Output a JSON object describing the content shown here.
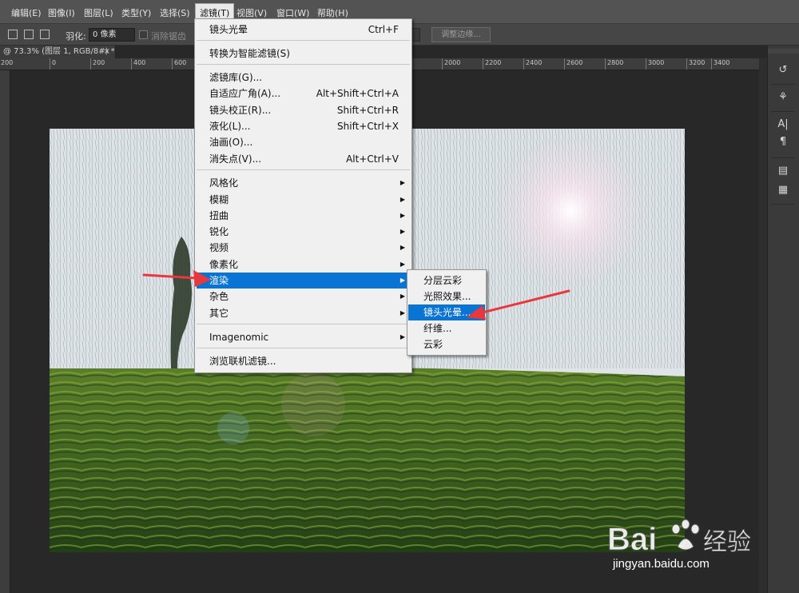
{
  "menubar": {
    "items": [
      {
        "label": "编辑(E)"
      },
      {
        "label": "图像(I)"
      },
      {
        "label": "图层(L)"
      },
      {
        "label": "类型(Y)"
      },
      {
        "label": "选择(S)"
      },
      {
        "label": "滤镜(T)",
        "active": true
      },
      {
        "label": "视图(V)"
      },
      {
        "label": "窗口(W)"
      },
      {
        "label": "帮助(H)"
      }
    ]
  },
  "options": {
    "feather_label": "羽化:",
    "feather_value": "0 像素",
    "antialias_label": "消除锯齿",
    "refine_edge_label": "调整边缘..."
  },
  "document": {
    "tab_title": "@ 73.3% (图层 1, RGB/8#) *",
    "close": "×"
  },
  "ruler": {
    "labels": [
      "200",
      "0",
      "200",
      "400",
      "600",
      "2000",
      "2200",
      "2400",
      "2600",
      "2800",
      "3000",
      "3200",
      "3400"
    ]
  },
  "filter_menu": {
    "items": [
      {
        "label": "镜头光晕",
        "shortcut": "Ctrl+F"
      },
      {
        "label": "转换为智能滤镜(S)"
      },
      {
        "label": "滤镜库(G)..."
      },
      {
        "label": "自适应广角(A)...",
        "shortcut": "Alt+Shift+Ctrl+A"
      },
      {
        "label": "镜头校正(R)...",
        "shortcut": "Shift+Ctrl+R"
      },
      {
        "label": "液化(L)...",
        "shortcut": "Shift+Ctrl+X"
      },
      {
        "label": "油画(O)..."
      },
      {
        "label": "消失点(V)...",
        "shortcut": "Alt+Ctrl+V"
      },
      {
        "label": "风格化",
        "submenu": true
      },
      {
        "label": "模糊",
        "submenu": true
      },
      {
        "label": "扭曲",
        "submenu": true
      },
      {
        "label": "锐化",
        "submenu": true
      },
      {
        "label": "视频",
        "submenu": true
      },
      {
        "label": "像素化",
        "submenu": true
      },
      {
        "label": "渲染",
        "submenu": true,
        "highlighted": true
      },
      {
        "label": "杂色",
        "submenu": true
      },
      {
        "label": "其它",
        "submenu": true
      },
      {
        "label": "Imagenomic",
        "submenu": true
      },
      {
        "label": "浏览联机滤镜..."
      }
    ],
    "arrow_glyph": "▶"
  },
  "render_submenu": {
    "items": [
      {
        "label": "分层云彩"
      },
      {
        "label": "光照效果..."
      },
      {
        "label": "镜头光晕...",
        "highlighted": true
      },
      {
        "label": "纤维..."
      },
      {
        "label": "云彩"
      }
    ]
  },
  "right_panel": {
    "icons": [
      "history-icon",
      "brush-settings-icon",
      "character-icon",
      "paragraph-icon",
      "layer-comps-icon",
      "notes-icon"
    ],
    "glyphs": [
      "↺",
      "⚘",
      "A|",
      "¶",
      "▤",
      "▦"
    ]
  },
  "colors": {
    "highlight": "#0a74d4",
    "arrow": "#e8383d",
    "menu_bg": "#f0f0f0"
  },
  "watermark": {
    "brand": "Bai",
    "brand_suffix": "经验",
    "url": "jingyan.baidu.com"
  }
}
